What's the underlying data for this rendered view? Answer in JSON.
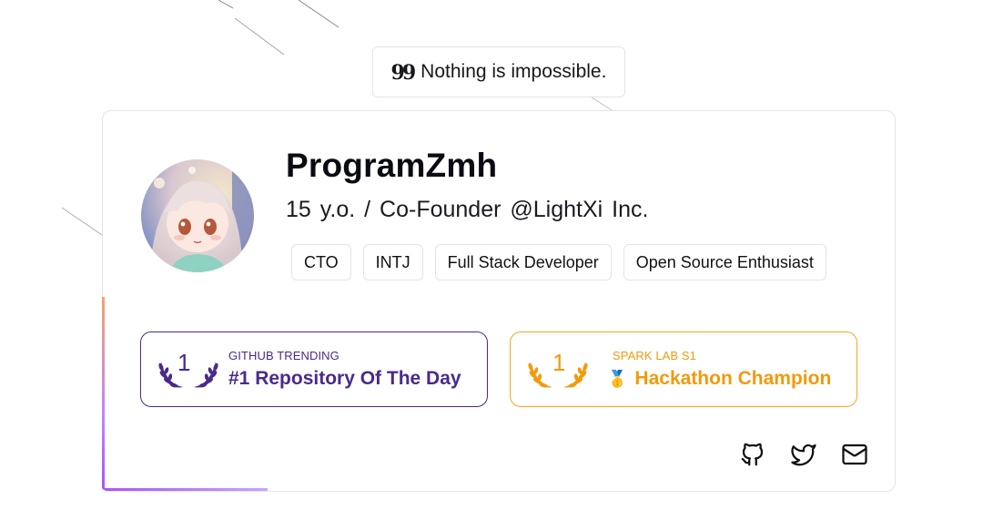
{
  "quote": {
    "icon": "quote-icon",
    "text": "Nothing is impossible."
  },
  "profile": {
    "name": "ProgramZmh",
    "subtitle": "15 y.o. / Co-Founder @LightXi Inc.",
    "tags": [
      "CTO",
      "INTJ",
      "Full Stack Developer",
      "Open Source Enthusiast"
    ]
  },
  "awards": [
    {
      "rank": "1",
      "label": "GITHUB TRENDING",
      "title": "#1 Repository Of The Day",
      "color": "#4a2a8c",
      "icon": "laurel-icon"
    },
    {
      "rank": "1",
      "label": "SPARK LAB S1",
      "medal": "🥇",
      "title": "Hackathon Champion",
      "color": "#f29a0c",
      "icon": "laurel-icon"
    }
  ],
  "social": [
    "github-icon",
    "twitter-icon",
    "mail-icon"
  ],
  "colors": {
    "border": "#e3e4e8",
    "accent_purple": "#a855f7",
    "accent_orange": "#f9a26b"
  }
}
